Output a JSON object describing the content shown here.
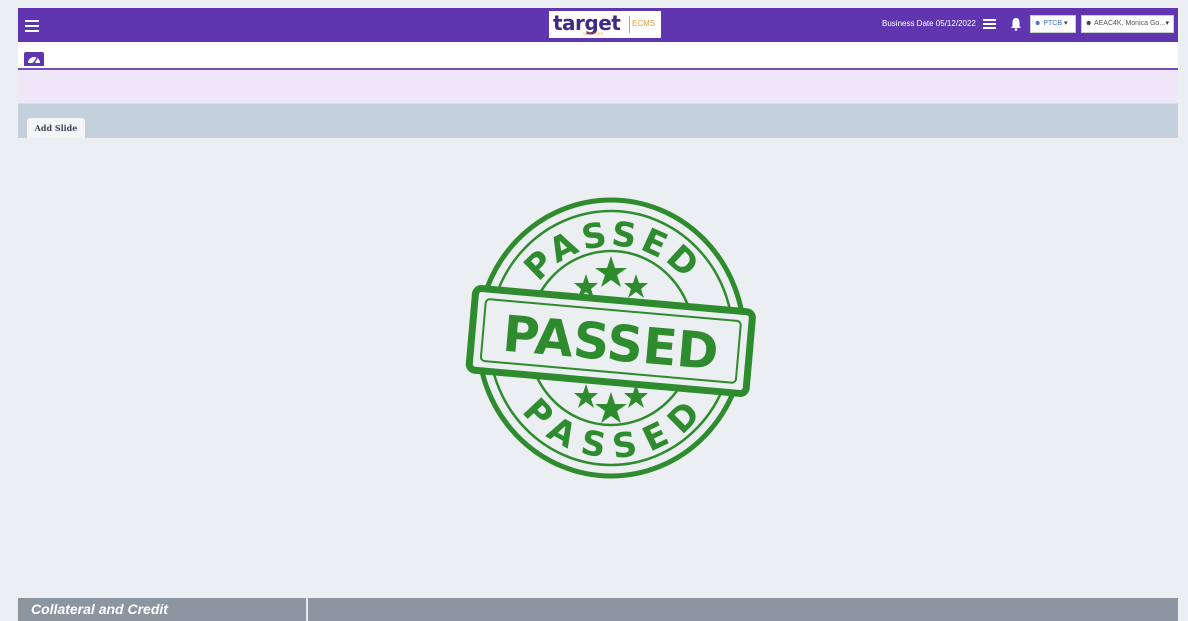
{
  "header": {
    "menu_icon": "hamburger-menu-icon",
    "logo_main": "target",
    "logo_small": "SERVICES",
    "logo_sub": "ECMS",
    "business_date": "Business Date 05/12/2022",
    "list_icon": "list-icon",
    "bell_icon": "bell-icon",
    "ptcb_label": "PTCB",
    "user_label": "AEAC4K, Monica Go...",
    "accent_color": "#5f36b0"
  },
  "toolbar": {
    "dashboard_icon": "dashboard-icon"
  },
  "tabs": [
    {
      "label": "Add Slide"
    }
  ],
  "content": {
    "stamp": {
      "arc_top": "PASSED",
      "center": "PASSED",
      "arc_bottom": "PASSED",
      "color": "#2e8b2e"
    }
  },
  "footer": {
    "title": "Collateral and Credit"
  }
}
